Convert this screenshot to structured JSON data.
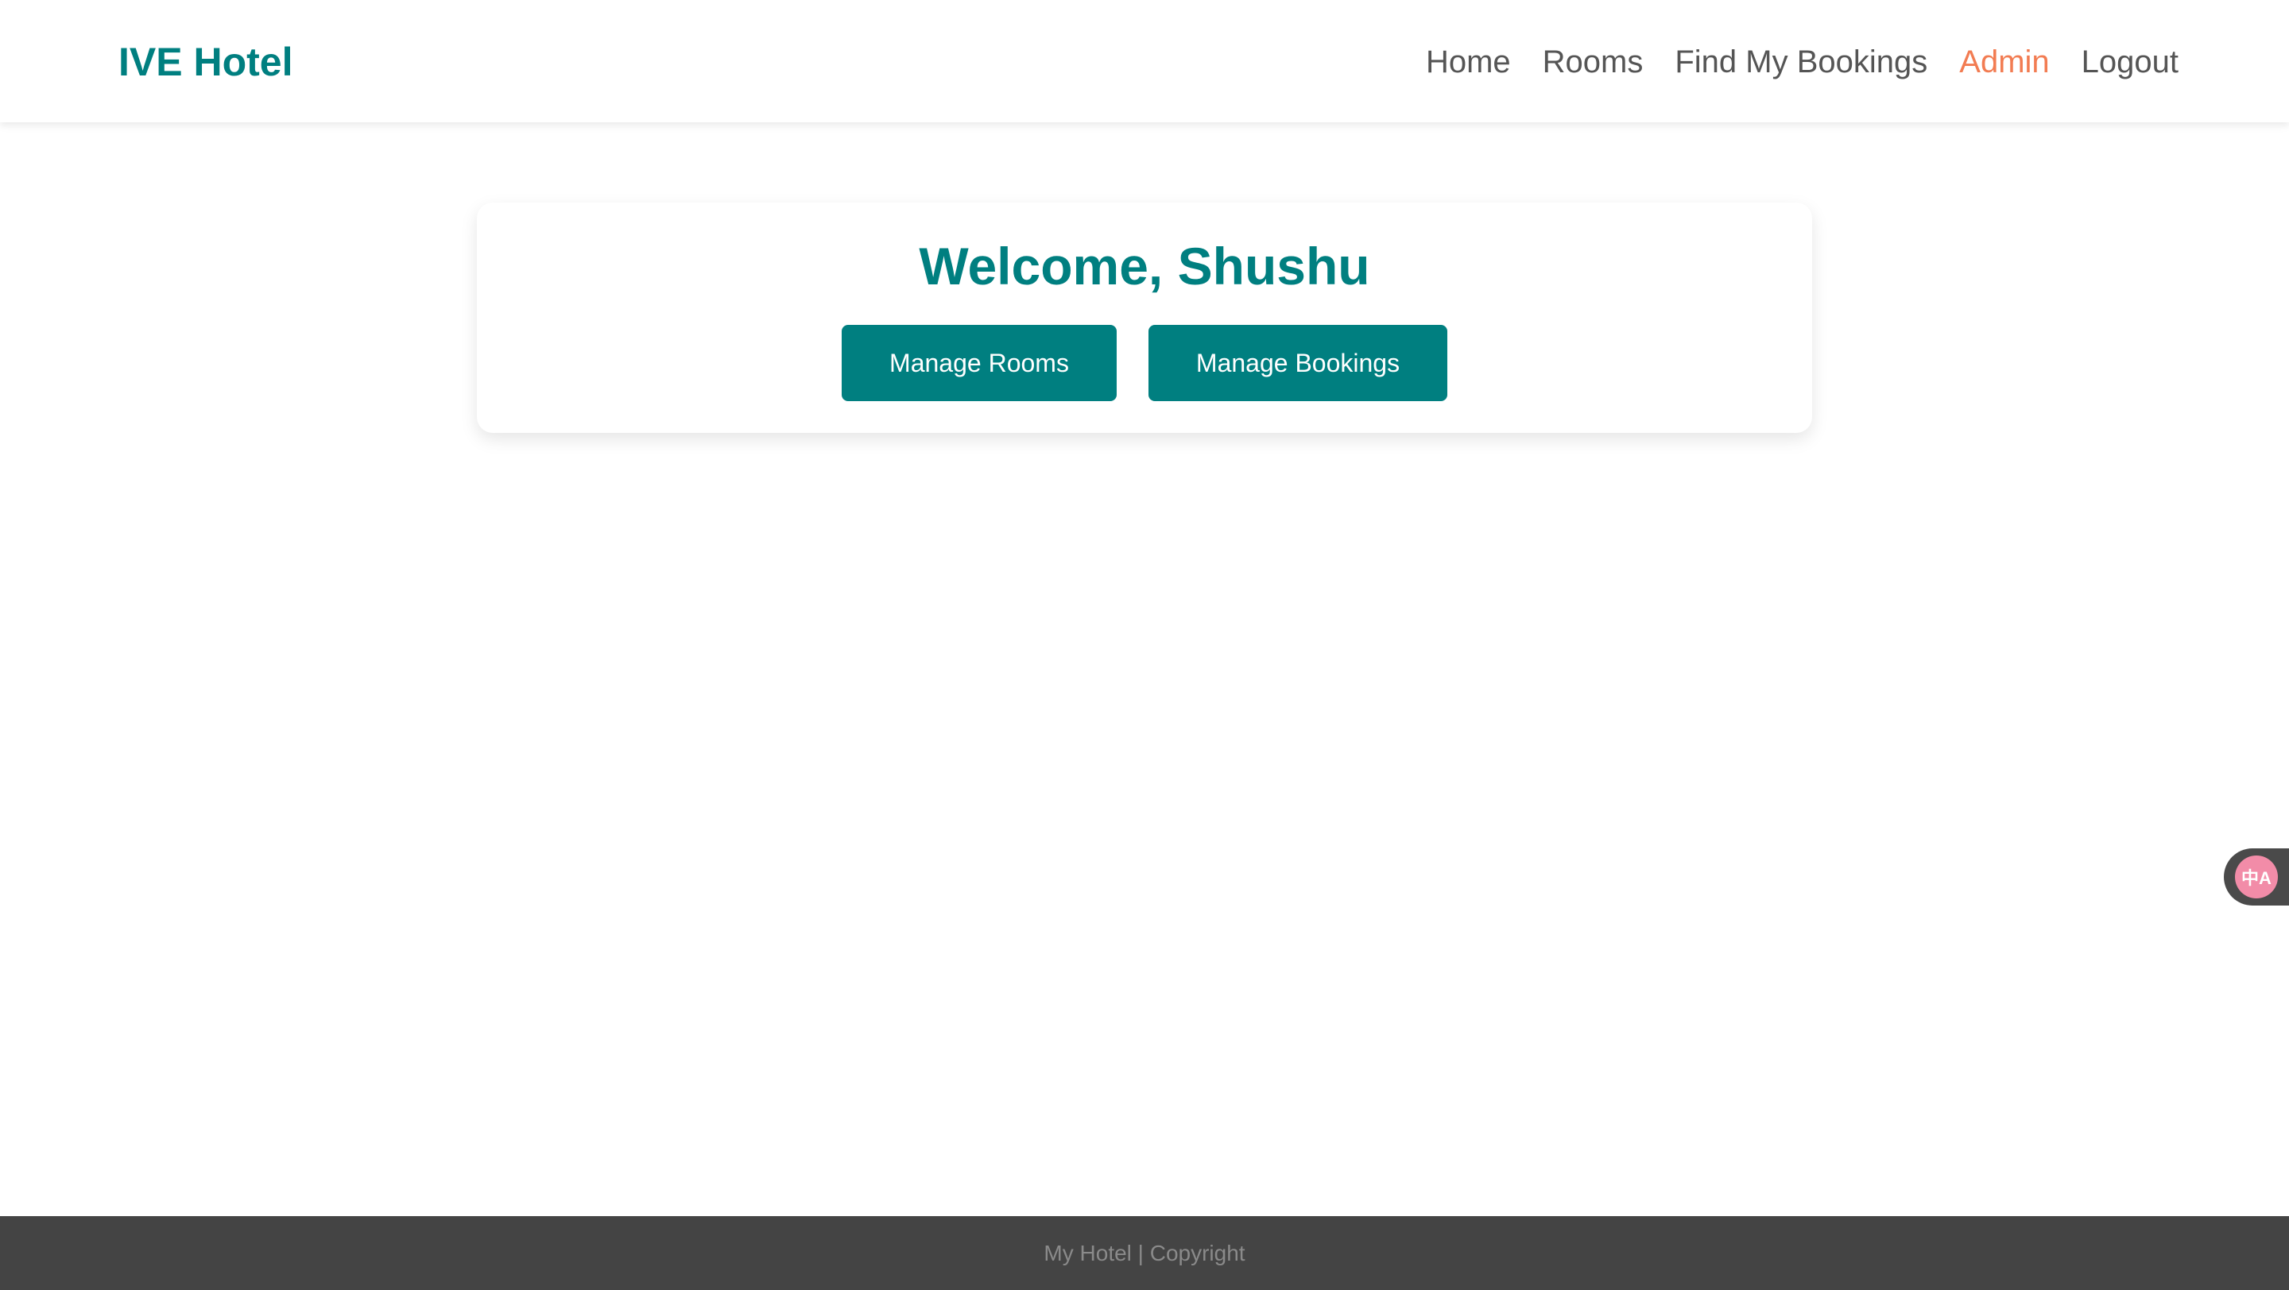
{
  "header": {
    "brand": "IVE Hotel",
    "nav": {
      "home": "Home",
      "rooms": "Rooms",
      "find_bookings": "Find My Bookings",
      "admin": "Admin",
      "logout": "Logout"
    },
    "active_item": "Admin"
  },
  "main": {
    "welcome_title": "Welcome, Shushu",
    "buttons": {
      "manage_rooms": "Manage Rooms",
      "manage_bookings": "Manage Bookings"
    }
  },
  "widget": {
    "icon": "translate-icon",
    "glyph": "中A"
  },
  "footer": {
    "text": "My Hotel | Copyright"
  },
  "colors": {
    "brand": "#007f80",
    "active_nav": "#f27c52",
    "nav_text": "#555555",
    "footer_bg": "#444444",
    "footer_text": "#8a8a8a",
    "widget_bg": "#4a4a4a",
    "widget_icon": "#f28ca8"
  }
}
